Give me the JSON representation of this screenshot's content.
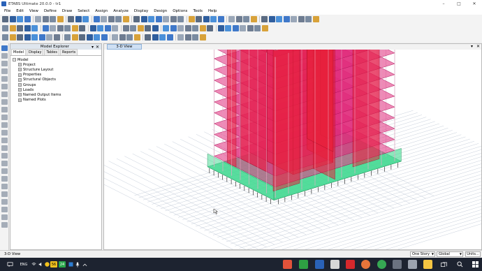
{
  "window": {
    "title": "ETABS Ultimate 20.0.0 - tr1",
    "minimize": "–",
    "maximize": "□",
    "close": "✕"
  },
  "menu": [
    "File",
    "Edit",
    "View",
    "Define",
    "Draw",
    "Select",
    "Assign",
    "Analyze",
    "Display",
    "Design",
    "Options",
    "Tools",
    "Help"
  ],
  "explorer": {
    "title": "Model Explorer",
    "pin": "▾",
    "close": "✕",
    "tabs": [
      "Model",
      "Display",
      "Tables",
      "Reports"
    ],
    "root": "Model",
    "items": [
      "Project",
      "Structure Layout",
      "Properties",
      "Structural Objects",
      "Groups",
      "Loads",
      "Named Output Items",
      "Named Plots"
    ]
  },
  "viewport": {
    "tab_label": "3-D View",
    "pin": "▾",
    "close": "✕"
  },
  "status": {
    "left_text": "3-D View",
    "story_select": "One Story",
    "coord_select": "Global",
    "units_button": "Units..."
  },
  "taskbar": {
    "language": "ENG",
    "badge_1": "56",
    "badge_2": "24"
  },
  "colors": {
    "building_slab": "#e0287a",
    "building_wall": "#e8203c",
    "foundation": "#40d890",
    "grid": "#b8c2d0",
    "tab_active": "#cfe0f4"
  }
}
